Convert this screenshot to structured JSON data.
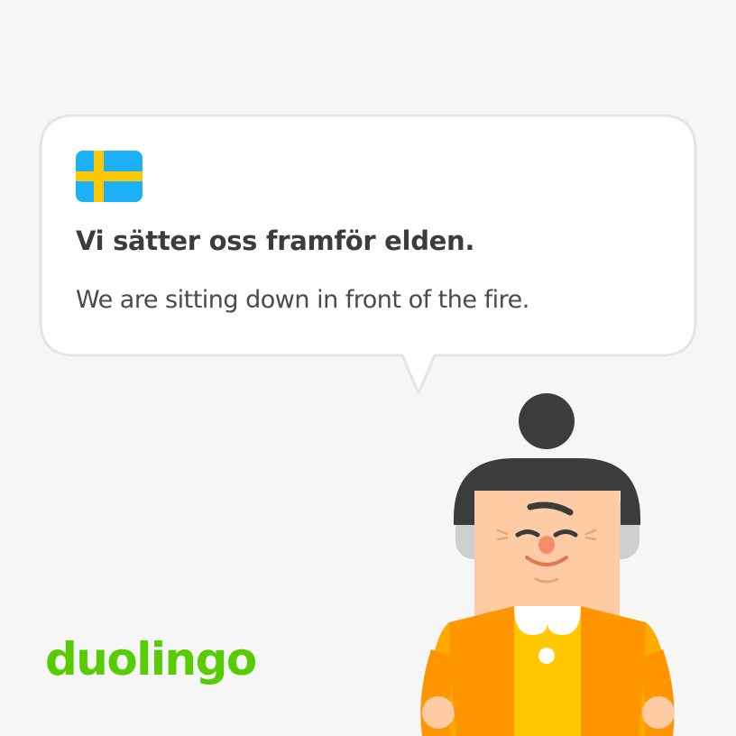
{
  "card": {
    "sentence": "Vi sätter oss framför elden.",
    "translation": "We are sitting down in front of the fire."
  },
  "flag": {
    "icon": "swedish-flag-icon",
    "field_color": "#1cb0f6",
    "cross_color": "#ffc800"
  },
  "brand": {
    "logo": "duolingo",
    "logo_color": "#58cc02"
  },
  "character": {
    "icon": "grandma-character-icon",
    "hair_color": "#3c3c3c",
    "skin_color": "#ffcba4",
    "jacket_color": "#ffaa00"
  },
  "colors": {
    "background": "#f6f6f6",
    "bubble_border": "#e5e5e5",
    "text_primary": "#3c3c3c"
  }
}
